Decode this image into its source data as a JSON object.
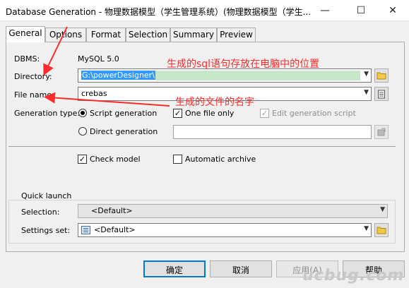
{
  "window": {
    "title": "Database Generation - 物理数据模型（学生管理系统）(物理数据模型（学生...",
    "minimize": "—",
    "maximize": "☐",
    "close": "✕"
  },
  "tabs": [
    "General",
    "Options",
    "Format",
    "Selection",
    "Summary",
    "Preview"
  ],
  "general": {
    "dbms_label": "DBMS:",
    "dbms_value": "MySQL 5.0",
    "directory_label": "Directory:",
    "directory_value": "G:\\powerDesigner\\",
    "filename_label": "File name:",
    "filename_value": "crebas",
    "gentype_label": "Generation type:",
    "script_generation": "Script generation",
    "direct_generation": "Direct generation",
    "one_file_only": "One file only",
    "edit_generation_script": "Edit generation script",
    "check_model": "Check model",
    "automatic_archive": "Automatic archive"
  },
  "quick_launch": {
    "title": "Quick launch",
    "selection_label": "Selection:",
    "selection_value": "<Default>",
    "settings_label": "Settings set:",
    "settings_value": "<Default>"
  },
  "buttons": {
    "ok": "确定",
    "cancel": "取消",
    "apply": "应用(A)",
    "help": "帮助"
  },
  "annotations": {
    "directory_note": "生成的sql语句存放在电脑中的位置",
    "filename_note": "生成的文件的名字"
  },
  "watermark": "ucbug.com",
  "colors": {
    "annotation": "#ff2a2a",
    "selection": "#3399ff",
    "default_button_border": "#0078d7"
  }
}
